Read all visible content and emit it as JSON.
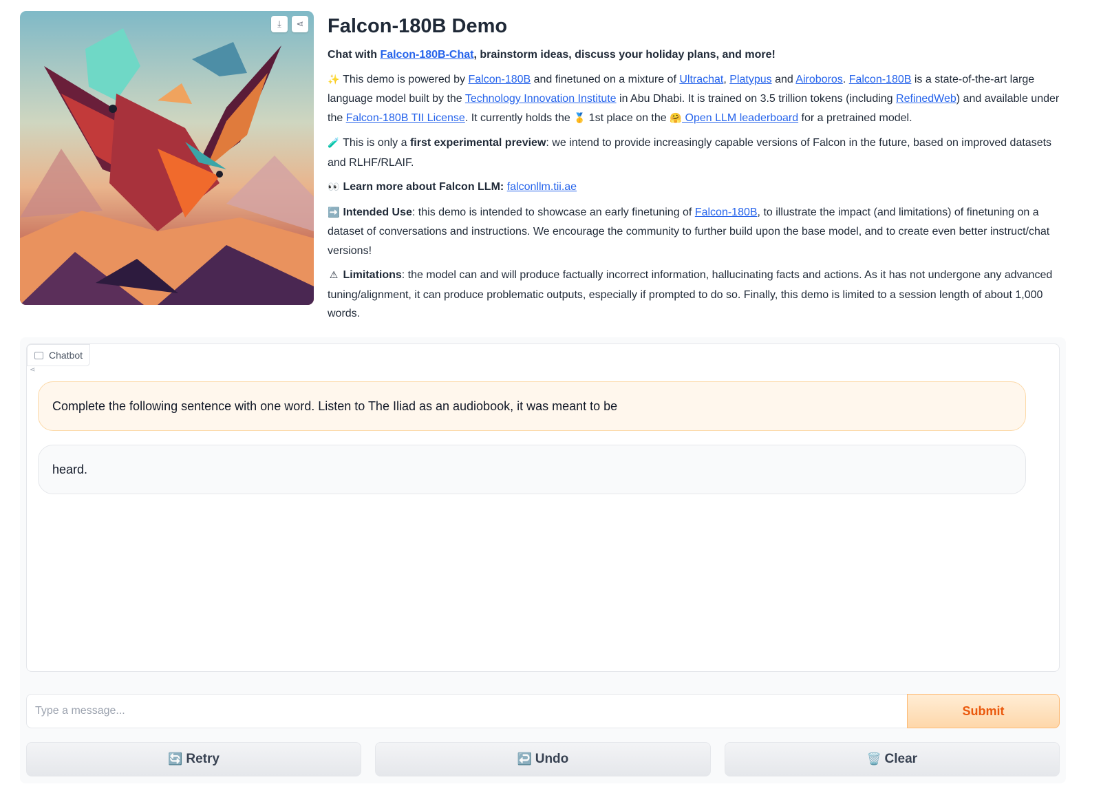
{
  "hero": {
    "image_alt": "low-poly falcon illustration",
    "download_icon": "download-icon",
    "share_icon": "share-icon"
  },
  "intro": {
    "title": "Falcon-180B Demo",
    "tagline_prefix": "Chat with ",
    "tagline_link": "Falcon-180B-Chat",
    "tagline_suffix": ", brainstorm ideas, discuss your holiday plans, and more!",
    "p1": {
      "icon": "✨",
      "t1": " This demo is powered by ",
      "l1": "Falcon-180B",
      "t2": " and finetuned on a mixture of ",
      "l2": "Ultrachat",
      "t3": ", ",
      "l3": "Platypus",
      "t4": " and ",
      "l4": "Airoboros",
      "t5": ". ",
      "l5": "Falcon-180B",
      "t6": " is a state-of-the-art large language model built by the ",
      "l6": "Technology Innovation Institute",
      "t7": " in Abu Dhabi. It is trained on 3.5 trillion tokens (including ",
      "l7": "RefinedWeb",
      "t8": ") and available under the ",
      "l8": "Falcon-180B TII License",
      "t9": ". It currently holds the ",
      "medal": "🥇",
      "t10": " 1st place on the ",
      "hug": "🤗",
      "l9": " Open LLM leaderboard",
      "t11": " for a pretrained model."
    },
    "p2": {
      "icon": "🧪",
      "t1": " This is only a ",
      "b1": "first experimental preview",
      "t2": ": we intend to provide increasingly capable versions of Falcon in the future, based on improved datasets and RLHF/RLAIF."
    },
    "p3": {
      "icon": "👀",
      "b1": " Learn more about Falcon LLM:",
      "t1": " ",
      "l1": "falconllm.tii.ae"
    },
    "p4": {
      "icon": "➡️",
      "b1": " Intended Use",
      "t1": ": this demo is intended to showcase an early finetuning of ",
      "l1": "Falcon-180B",
      "t2": ", to illustrate the impact (and limitations) of finetuning on a dataset of conversations and instructions. We encourage the community to further build upon the base model, and to create even better instruct/chat versions!"
    },
    "p5": {
      "icon": "⚠",
      "b1": " Limitations",
      "t1": ": the model can and will produce factually incorrect information, hallucinating facts and actions. As it has not undergone any advanced tuning/alignment, it can produce problematic outputs, especially if prompted to do so. Finally, this demo is limited to a session length of about 1,000 words."
    }
  },
  "chat": {
    "label": "Chatbot",
    "messages": [
      {
        "role": "user",
        "text": "Complete the following sentence with one word. Listen to The Iliad as an audiobook, it was meant to be"
      },
      {
        "role": "bot",
        "text": "heard."
      }
    ]
  },
  "composer": {
    "placeholder": "Type a message...",
    "submit_label": "Submit"
  },
  "actions": {
    "retry_icon": "🔄",
    "retry_label": "Retry",
    "undo_icon": "↩️",
    "undo_label": "Undo",
    "clear_icon": "🗑️",
    "clear_label": "Clear"
  }
}
